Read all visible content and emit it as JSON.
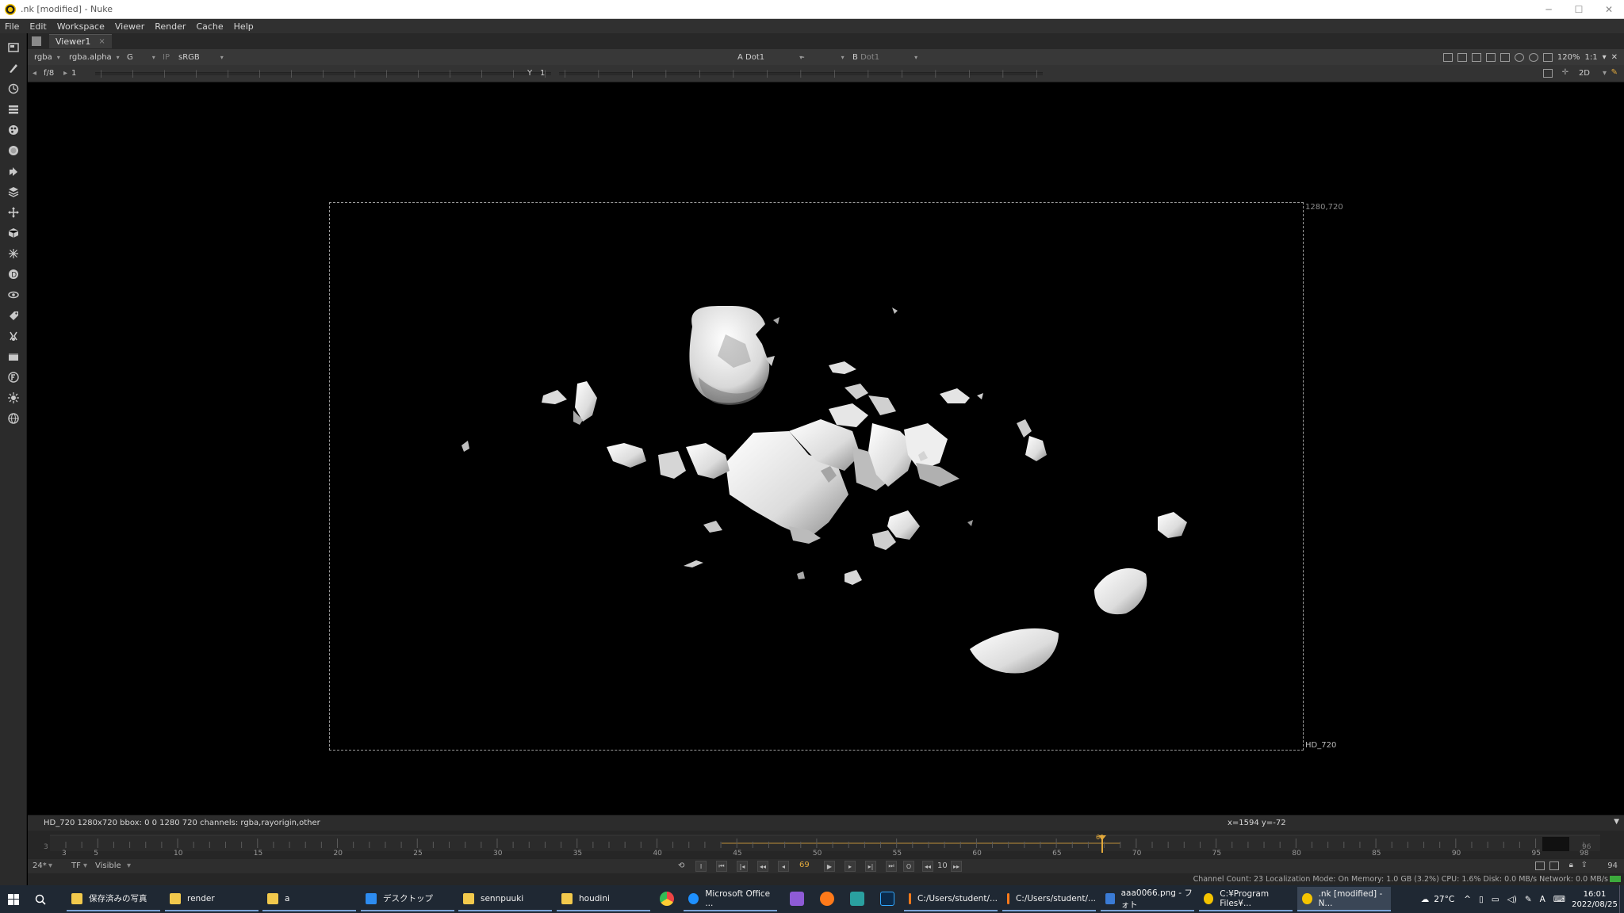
{
  "window": {
    "title": ".nk [modified] - Nuke",
    "controls": [
      "─",
      "☐",
      "✕"
    ]
  },
  "menubar": [
    "File",
    "Edit",
    "Workspace",
    "Viewer",
    "Render",
    "Cache",
    "Help"
  ],
  "viewer_tab": {
    "label": "Viewer1",
    "close": "×"
  },
  "controls_row1": {
    "channels": "rgba",
    "alpha_channel": "rgba.alpha",
    "display_channel": "G",
    "ip_label": "IP",
    "colorspace": "sRGB",
    "a_label": "A",
    "a_input": "Dot1",
    "operation": "-",
    "b_label": "B",
    "b_input": "Dot1",
    "zoom": "120%",
    "proxy": "1:1"
  },
  "controls_row2": {
    "fstop": "f/8",
    "gain_value": "1",
    "gamma_label": "Y",
    "gamma_value": "1",
    "view_mode": "2D"
  },
  "viewer": {
    "format_top_right": "1280,720",
    "format_bottom_right": "HD_720"
  },
  "infobar": {
    "left": "HD_720 1280x720  bbox: 0 0 1280 720 channels: rgba,rayorigin,other",
    "right": "x=1594 y=-72"
  },
  "timeline": {
    "start_frame": "3",
    "end_frame": "96",
    "current_frame": "69",
    "labels": [
      "3",
      "5",
      "10",
      "15",
      "20",
      "25",
      "30",
      "35",
      "40",
      "45",
      "50",
      "55",
      "60",
      "65",
      "70",
      "75",
      "80",
      "85",
      "90",
      "95",
      "98"
    ],
    "playhead_label": "69"
  },
  "playback": {
    "fps": "24*",
    "tf": "TF",
    "visible": "Visible",
    "current_frame": "69",
    "increment": "10",
    "end_frame": "94"
  },
  "statusbar": {
    "text": "Channel Count: 23  Localization Mode: On  Memory: 1.0 GB (3.2%)  CPU: 1.6%  Disk: 0.0 MB/s  Network: 0.0 MB/s"
  },
  "taskbar": {
    "items": [
      {
        "label": "保存済みの写真",
        "color": "#f2c94c"
      },
      {
        "label": "render",
        "color": "#f2c94c"
      },
      {
        "label": "a",
        "color": "#f2c94c"
      },
      {
        "label": "デスクトップ",
        "color": "#2d8cf0"
      },
      {
        "label": "sennpuuki",
        "color": "#f2c94c"
      },
      {
        "label": "houdini",
        "color": "#f2c94c"
      },
      {
        "label": "Microsoft Office ...",
        "color": "#1e90ff"
      },
      {
        "label": "C:/Users/student/...",
        "color": "#ff7a1a"
      },
      {
        "label": "C:/Users/student/...",
        "color": "#ff7a1a"
      },
      {
        "label": "aaa0066.png - フォト",
        "color": "#3a7bd5"
      },
      {
        "label": "C:¥Program Files¥...",
        "color": "#f5c400"
      },
      {
        "label": ".nk [modified] - N...",
        "color": "#f5c400"
      }
    ],
    "weather": "27°C",
    "ime": "A",
    "time": "16:01",
    "date": "2022/08/25"
  }
}
